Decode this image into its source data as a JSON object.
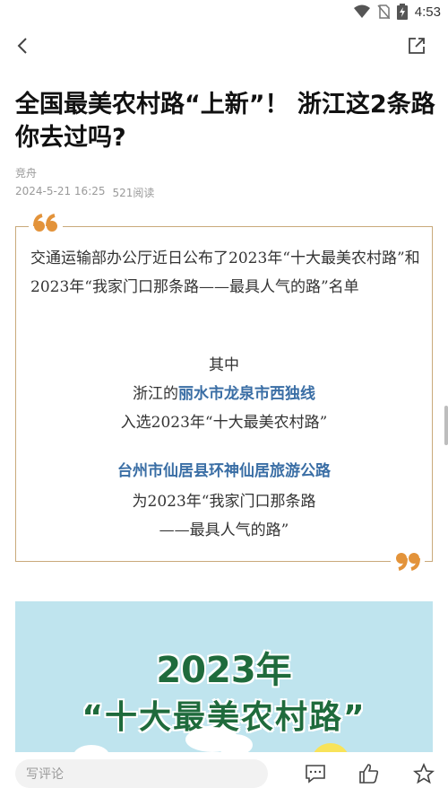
{
  "status": {
    "time": "4:53"
  },
  "article": {
    "title": "全国最美农村路“上新”！ 浙江这2条路你去过吗?",
    "author": "竞舟",
    "date": "2024-5-21  16:25",
    "reads": "521阅读"
  },
  "quote": {
    "intro": "交通运输部办公厅近日公布了2023年“十大最美农村路”和2023年“我家门口那条路——最具人气的路”名单",
    "line1": "其中",
    "line2_prefix": "浙江的",
    "line2_highlight": "丽水市龙泉市西独线",
    "line3": "入选2023年“十大最美农村路”",
    "line4_highlight": "台州市仙居县环神仙居旅游公路",
    "line5": "为2023年“我家门口那条路",
    "line6": "——最具人气的路”"
  },
  "banner": {
    "year": "2023年",
    "title": "“十大最美农村路”"
  },
  "bottom": {
    "comment_placeholder": "写评论"
  },
  "colors": {
    "accent_blue": "#3a6ea5",
    "quote_gold": "#e3933a",
    "border_gold": "#c9a97a",
    "banner_green": "#1f6b3c"
  }
}
